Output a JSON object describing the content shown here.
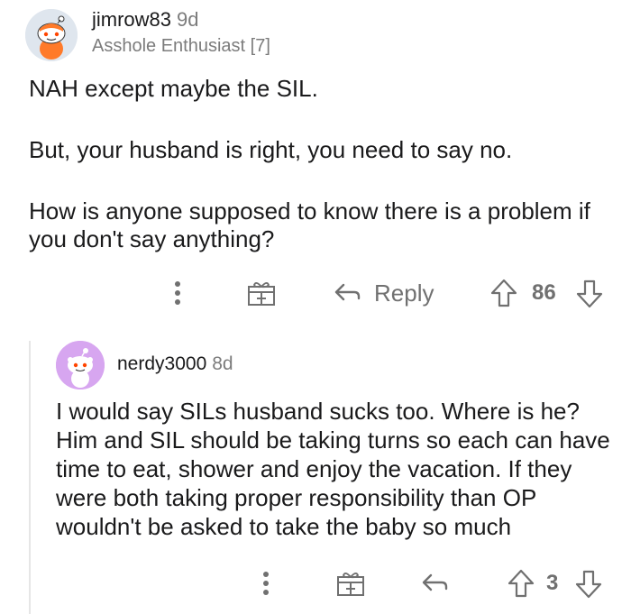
{
  "comment1": {
    "username": "jimrow83",
    "age": "9d",
    "flair": "Asshole Enthusiast [7]",
    "paragraphs": [
      "NAH except maybe the SIL.",
      "But, your husband is right, you need to say no.",
      "How is anyone supposed to know there is a problem if you don't say anything?"
    ],
    "actions": {
      "reply_label": "Reply",
      "vote_count": "86"
    }
  },
  "comment2": {
    "username": "nerdy3000",
    "age": "8d",
    "body": "I would say SILs husband sucks too. Where is he? Him and SIL should be taking turns so each can have time to eat, shower and enjoy the vacation. If they were both taking proper responsibility than OP wouldn't be asked to take the baby so much",
    "actions": {
      "vote_count": "3"
    }
  },
  "icons": {
    "more": "more-options-icon",
    "award": "award-gift-icon",
    "reply": "reply-arrow-icon",
    "upvote": "upvote-arrow-icon",
    "downvote": "downvote-arrow-icon"
  }
}
